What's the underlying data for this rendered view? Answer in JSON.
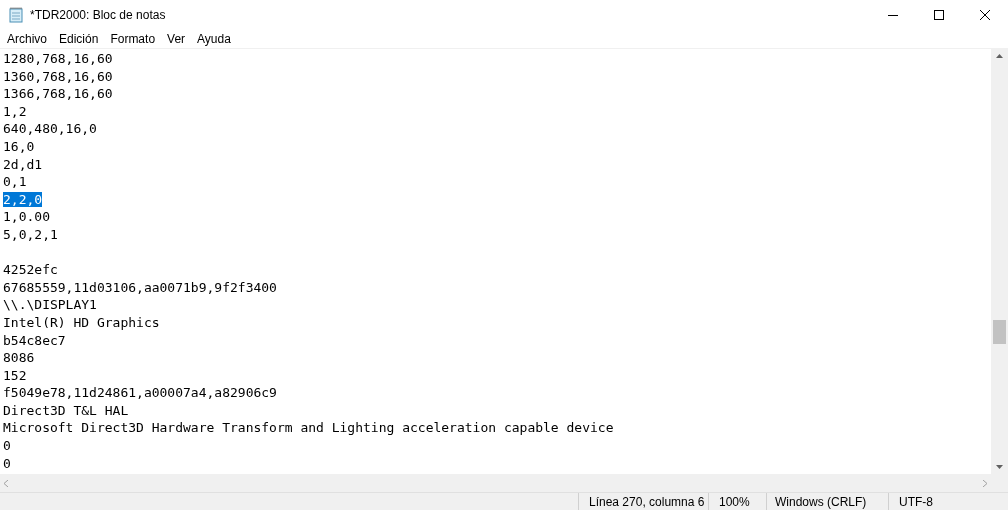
{
  "window": {
    "title": "*TDR2000: Bloc de notas"
  },
  "menu": [
    "Archivo",
    "Edición",
    "Formato",
    "Ver",
    "Ayuda"
  ],
  "lines": [
    {
      "kind": "text",
      "text": "1280,768,16,60",
      "selected": false
    },
    {
      "kind": "text",
      "text": "1360,768,16,60",
      "selected": false
    },
    {
      "kind": "text",
      "text": "1366,768,16,60",
      "selected": false
    },
    {
      "kind": "text",
      "text": "1,2",
      "selected": false
    },
    {
      "kind": "text",
      "text": "640,480,16,0",
      "selected": false
    },
    {
      "kind": "text",
      "text": "16,0",
      "selected": false
    },
    {
      "kind": "text",
      "text": "2d,d1",
      "selected": false
    },
    {
      "kind": "text",
      "text": "0,1",
      "selected": false
    },
    {
      "kind": "text",
      "text": "2,2,0",
      "selected": true
    },
    {
      "kind": "text",
      "text": "1,0.00",
      "selected": false
    },
    {
      "kind": "text",
      "text": "5,0,2,1",
      "selected": false
    },
    {
      "kind": "blank",
      "selected": false
    },
    {
      "kind": "text",
      "text": "4252efc",
      "selected": false
    },
    {
      "kind": "text",
      "text": "67685559,11d03106,aa0071b9,9f2f3400",
      "selected": false
    },
    {
      "kind": "text",
      "text": "\\\\.\\DISPLAY1",
      "selected": false
    },
    {
      "kind": "text",
      "text": "Intel(R) HD Graphics",
      "selected": false
    },
    {
      "kind": "text",
      "text": "b54c8ec7",
      "selected": false
    },
    {
      "kind": "text",
      "text": "8086",
      "selected": false
    },
    {
      "kind": "text",
      "text": "152",
      "selected": false
    },
    {
      "kind": "text",
      "text": "f5049e78,11d24861,a00007a4,a82906c9",
      "selected": false
    },
    {
      "kind": "text",
      "text": "Direct3D T&L HAL",
      "selected": false
    },
    {
      "kind": "text",
      "text": "Microsoft Direct3D Hardware Transform and Lighting acceleration capable device",
      "selected": false
    },
    {
      "kind": "text",
      "text": "0",
      "selected": false
    },
    {
      "kind": "text",
      "text": "0",
      "selected": false
    }
  ],
  "status_bar": {
    "position": "Línea 270, columna 6",
    "zoom": "100%",
    "line_ending": "Windows (CRLF)",
    "encoding": "UTF-8"
  }
}
